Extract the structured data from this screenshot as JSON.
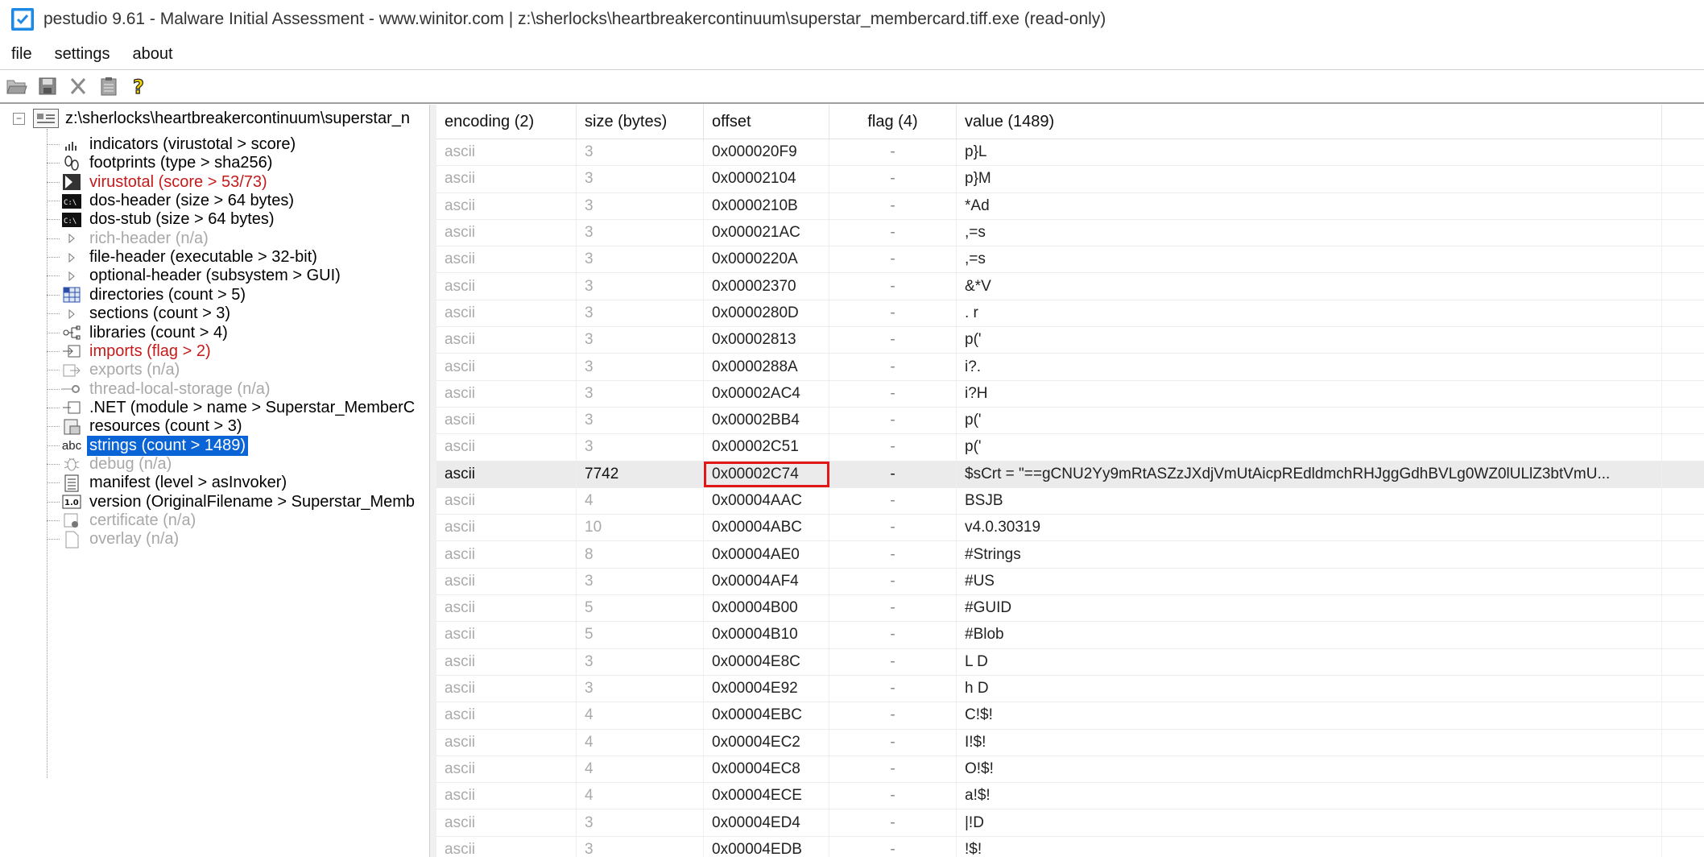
{
  "window": {
    "title": "pestudio 9.61 - Malware Initial Assessment - www.winitor.com | z:\\sherlocks\\heartbreakercontinuum\\superstar_membercard.tiff.exe (read-only)"
  },
  "menu": {
    "file": "file",
    "settings": "settings",
    "about": "about"
  },
  "toolbar": [
    "open-icon",
    "save-icon",
    "cut-icon",
    "clipboard-icon",
    "help-icon"
  ],
  "tree": {
    "root": "z:\\sherlocks\\heartbreakercontinuum\\superstar_n",
    "items": [
      {
        "label": "indicators (virustotal > score)",
        "icon": "bar-chart-icon",
        "style": "normal"
      },
      {
        "label": "footprints (type > sha256)",
        "icon": "footprints-icon",
        "style": "normal"
      },
      {
        "label": "virustotal (score > 53/73)",
        "icon": "virustotal-icon",
        "style": "red"
      },
      {
        "label": "dos-header (size > 64 bytes)",
        "icon": "console-icon",
        "style": "normal"
      },
      {
        "label": "dos-stub (size > 64 bytes)",
        "icon": "console-icon",
        "style": "normal"
      },
      {
        "label": "rich-header (n/a)",
        "icon": "triangle-icon",
        "style": "gray"
      },
      {
        "label": "file-header (executable > 32-bit)",
        "icon": "triangle-icon",
        "style": "normal"
      },
      {
        "label": "optional-header (subsystem > GUI)",
        "icon": "triangle-icon",
        "style": "normal"
      },
      {
        "label": "directories (count > 5)",
        "icon": "grid-icon",
        "style": "normal"
      },
      {
        "label": "sections (count > 3)",
        "icon": "triangle-icon",
        "style": "normal"
      },
      {
        "label": "libraries (count > 4)",
        "icon": "libraries-icon",
        "style": "normal"
      },
      {
        "label": "imports (flag > 2)",
        "icon": "imports-icon",
        "style": "red"
      },
      {
        "label": "exports (n/a)",
        "icon": "exports-icon",
        "style": "gray"
      },
      {
        "label": "thread-local-storage (n/a)",
        "icon": "tls-icon",
        "style": "gray"
      },
      {
        "label": ".NET (module > name > Superstar_MemberC",
        "icon": "dotnet-icon",
        "style": "normal"
      },
      {
        "label": "resources (count > 3)",
        "icon": "resources-icon",
        "style": "normal"
      },
      {
        "label": "strings (count > 1489)",
        "icon": "abc-icon",
        "style": "selected"
      },
      {
        "label": "debug (n/a)",
        "icon": "bug-icon",
        "style": "gray"
      },
      {
        "label": "manifest (level > asInvoker)",
        "icon": "manifest-icon",
        "style": "normal"
      },
      {
        "label": "version (OriginalFilename > Superstar_Memb",
        "icon": "version-icon",
        "style": "normal"
      },
      {
        "label": "certificate (n/a)",
        "icon": "certificate-icon",
        "style": "gray"
      },
      {
        "label": "overlay (n/a)",
        "icon": "page-icon",
        "style": "gray"
      }
    ]
  },
  "table": {
    "headers": {
      "encoding": "encoding (2)",
      "size": "size (bytes)",
      "offset": "offset",
      "flag": "flag (4)",
      "value": "value (1489)"
    },
    "rows": [
      {
        "encoding": "ascii",
        "size": "3",
        "offset": "0x000020F9",
        "flag": "-",
        "value": "p}L"
      },
      {
        "encoding": "ascii",
        "size": "3",
        "offset": "0x00002104",
        "flag": "-",
        "value": "p}M"
      },
      {
        "encoding": "ascii",
        "size": "3",
        "offset": "0x0000210B",
        "flag": "-",
        "value": "*Ad"
      },
      {
        "encoding": "ascii",
        "size": "3",
        "offset": "0x000021AC",
        "flag": "-",
        "value": ",=s"
      },
      {
        "encoding": "ascii",
        "size": "3",
        "offset": "0x0000220A",
        "flag": "-",
        "value": ",=s"
      },
      {
        "encoding": "ascii",
        "size": "3",
        "offset": "0x00002370",
        "flag": "-",
        "value": "&*V"
      },
      {
        "encoding": "ascii",
        "size": "3",
        "offset": "0x0000280D",
        "flag": "-",
        "value": ". r"
      },
      {
        "encoding": "ascii",
        "size": "3",
        "offset": "0x00002813",
        "flag": "-",
        "value": "p('"
      },
      {
        "encoding": "ascii",
        "size": "3",
        "offset": "0x0000288A",
        "flag": "-",
        "value": "i?."
      },
      {
        "encoding": "ascii",
        "size": "3",
        "offset": "0x00002AC4",
        "flag": "-",
        "value": "i?H"
      },
      {
        "encoding": "ascii",
        "size": "3",
        "offset": "0x00002BB4",
        "flag": "-",
        "value": "p('"
      },
      {
        "encoding": "ascii",
        "size": "3",
        "offset": "0x00002C51",
        "flag": "-",
        "value": "p('"
      },
      {
        "encoding": "ascii",
        "size": "7742",
        "offset": "0x00002C74",
        "flag": "-",
        "value": "$sCrt = \"==gCNU2Yy9mRtASZzJXdjVmUtAicpREdldmchRHJggGdhBVLg0WZ0lULlZ3btVmU...",
        "highlight": true
      },
      {
        "encoding": "ascii",
        "size": "4",
        "offset": "0x00004AAC",
        "flag": "-",
        "value": "BSJB"
      },
      {
        "encoding": "ascii",
        "size": "10",
        "offset": "0x00004ABC",
        "flag": "-",
        "value": "v4.0.30319"
      },
      {
        "encoding": "ascii",
        "size": "8",
        "offset": "0x00004AE0",
        "flag": "-",
        "value": "#Strings"
      },
      {
        "encoding": "ascii",
        "size": "3",
        "offset": "0x00004AF4",
        "flag": "-",
        "value": "#US"
      },
      {
        "encoding": "ascii",
        "size": "5",
        "offset": "0x00004B00",
        "flag": "-",
        "value": "#GUID"
      },
      {
        "encoding": "ascii",
        "size": "5",
        "offset": "0x00004B10",
        "flag": "-",
        "value": "#Blob"
      },
      {
        "encoding": "ascii",
        "size": "3",
        "offset": "0x00004E8C",
        "flag": "-",
        "value": "L D"
      },
      {
        "encoding": "ascii",
        "size": "3",
        "offset": "0x00004E92",
        "flag": "-",
        "value": "h D"
      },
      {
        "encoding": "ascii",
        "size": "4",
        "offset": "0x00004EBC",
        "flag": "-",
        "value": "C!$!"
      },
      {
        "encoding": "ascii",
        "size": "4",
        "offset": "0x00004EC2",
        "flag": "-",
        "value": "I!$!"
      },
      {
        "encoding": "ascii",
        "size": "4",
        "offset": "0x00004EC8",
        "flag": "-",
        "value": "O!$!"
      },
      {
        "encoding": "ascii",
        "size": "4",
        "offset": "0x00004ECE",
        "flag": "-",
        "value": "a!$!"
      },
      {
        "encoding": "ascii",
        "size": "3",
        "offset": "0x00004ED4",
        "flag": "-",
        "value": "|!D"
      },
      {
        "encoding": "ascii",
        "size": "3",
        "offset": "0x00004EDB",
        "flag": "-",
        "value": "!$!"
      }
    ]
  }
}
